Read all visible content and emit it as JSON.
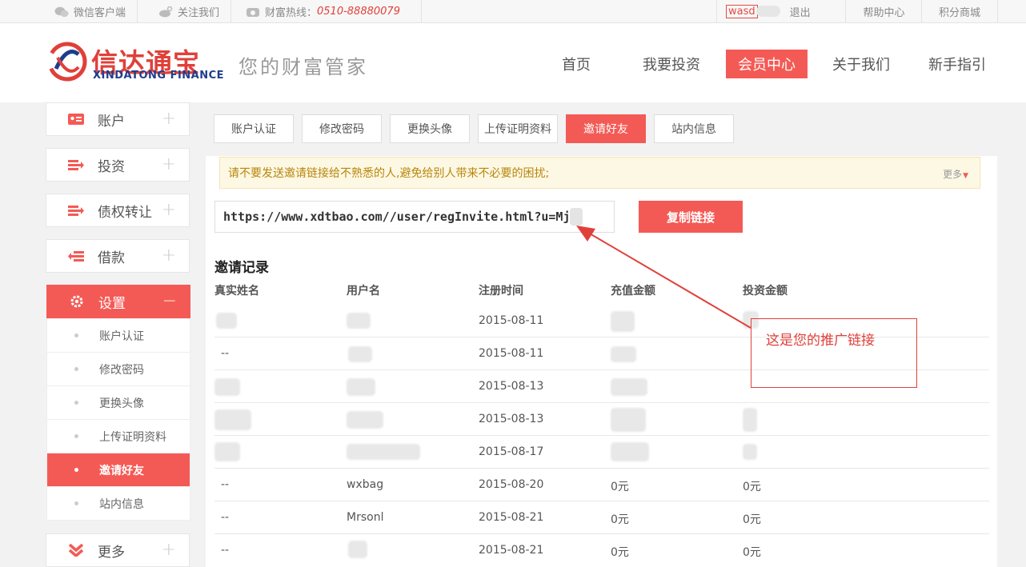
{
  "topbar": {
    "wechat": "微信客户端",
    "follow": "关注我们",
    "hotline_label": "财富热线：",
    "hotline_number": "0510-88880079",
    "username": "wasd",
    "logout": "退出",
    "help": "帮助中心",
    "points_mall": "积分商城"
  },
  "header": {
    "logo_cn": "信达通宝",
    "logo_en": "XINDATONG FINANCE",
    "slogan": "您的财富管家",
    "nav": [
      "首页",
      "我要投资",
      "会员中心",
      "关于我们",
      "新手指引"
    ]
  },
  "sidebar": {
    "account": "账户",
    "invest": "投资",
    "transfer": "债权转让",
    "borrow": "借款",
    "settings": "设置",
    "settings_items": [
      "账户认证",
      "修改密码",
      "更换头像",
      "上传证明资料",
      "邀请好友",
      "站内信息"
    ],
    "more": "更多"
  },
  "tabs": [
    "账户认证",
    "修改密码",
    "更换头像",
    "上传证明资料",
    "邀请好友",
    "站内信息"
  ],
  "notice": {
    "text": "请不要发送邀请链接给不熟悉的人,避免给别人带来不必要的困扰;",
    "more": "更多"
  },
  "invite": {
    "link": "https://www.xdtbao.com//user/regInvite.html?u=Mj",
    "copy_button": "复制链接"
  },
  "records": {
    "title": "邀请记录",
    "headers": [
      "真实姓名",
      "用户名",
      "注册时间",
      "充值金额",
      "投资金额"
    ],
    "rows": [
      {
        "name": "",
        "user": "",
        "date": "2015-08-11",
        "recharge": "",
        "invest": ""
      },
      {
        "name": "--",
        "user": "",
        "date": "2015-08-11",
        "recharge": "",
        "invest": ""
      },
      {
        "name": "",
        "user": "",
        "date": "2015-08-13",
        "recharge": "",
        "invest": ""
      },
      {
        "name": "",
        "user": "",
        "date": "2015-08-13",
        "recharge": "",
        "invest": ""
      },
      {
        "name": "",
        "user": "",
        "date": "2015-08-17",
        "recharge": "",
        "invest": ""
      },
      {
        "name": "--",
        "user": "wxbag",
        "date": "2015-08-20",
        "recharge": "0元",
        "invest": "0元"
      },
      {
        "name": "--",
        "user": "Mrsonl",
        "date": "2015-08-21",
        "recharge": "0元",
        "invest": "0元"
      },
      {
        "name": "--",
        "user": "",
        "date": "2015-08-21",
        "recharge": "0元",
        "invest": "0元"
      }
    ]
  },
  "annotation": {
    "text": "这是您的推广链接"
  },
  "colors": {
    "accent": "#f45a55",
    "brand_blue": "#1f3d8c",
    "callout_red": "#e0403a"
  }
}
